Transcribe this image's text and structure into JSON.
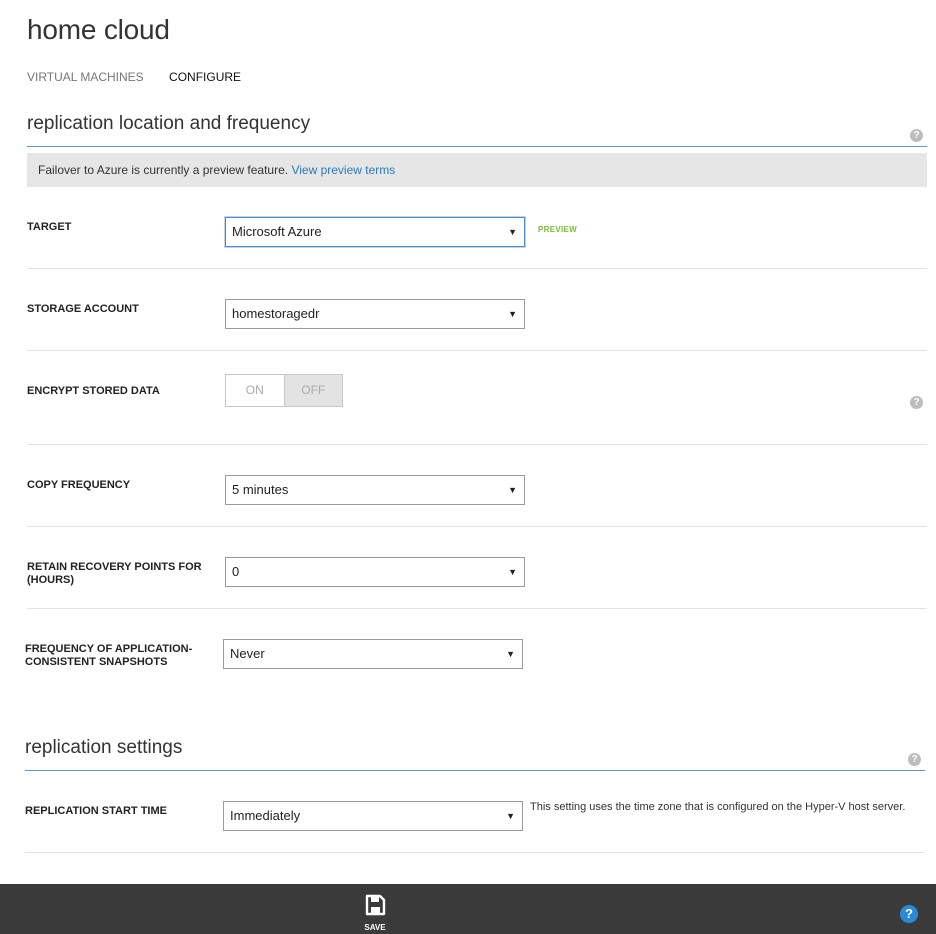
{
  "page": {
    "title": "home cloud"
  },
  "nav": {
    "tabs": [
      {
        "label": "VIRTUAL MACHINES"
      },
      {
        "label": "CONFIGURE"
      }
    ]
  },
  "section1": {
    "title": "replication location and frequency",
    "help": "?",
    "banner": {
      "text": "Failover to Azure is currently a preview feature.",
      "link": "View preview terms"
    },
    "target": {
      "label": "TARGET",
      "value": "Microsoft Azure",
      "badge": "PREVIEW"
    },
    "storage": {
      "label": "STORAGE ACCOUNT",
      "value": "homestoragedr"
    },
    "encrypt": {
      "label": "ENCRYPT STORED DATA",
      "on": "ON",
      "off": "OFF",
      "state": "OFF",
      "help": "?"
    },
    "copy_freq": {
      "label": "COPY FREQUENCY",
      "value": "5 minutes"
    },
    "retain": {
      "label_line1": "RETAIN RECOVERY POINTS FOR",
      "label_line2": "(HOURS)",
      "value": "0"
    },
    "snapshots": {
      "label_line1": "FREQUENCY OF APPLICATION-",
      "label_line2": "CONSISTENT SNAPSHOTS",
      "value": "Never"
    }
  },
  "section2": {
    "title": "replication settings",
    "help": "?",
    "start_time": {
      "label": "REPLICATION START TIME",
      "value": "Immediately",
      "note": "This setting uses the time zone that is configured on the Hyper-V host server."
    }
  },
  "footer": {
    "save_label": "SAVE",
    "help": "?"
  },
  "colors": {
    "accent": "#5b9bd5",
    "link": "#2a7ab8",
    "preview": "#7dbb3a",
    "footer": "#3a3a3a",
    "help_blue": "#2a8ad4"
  }
}
